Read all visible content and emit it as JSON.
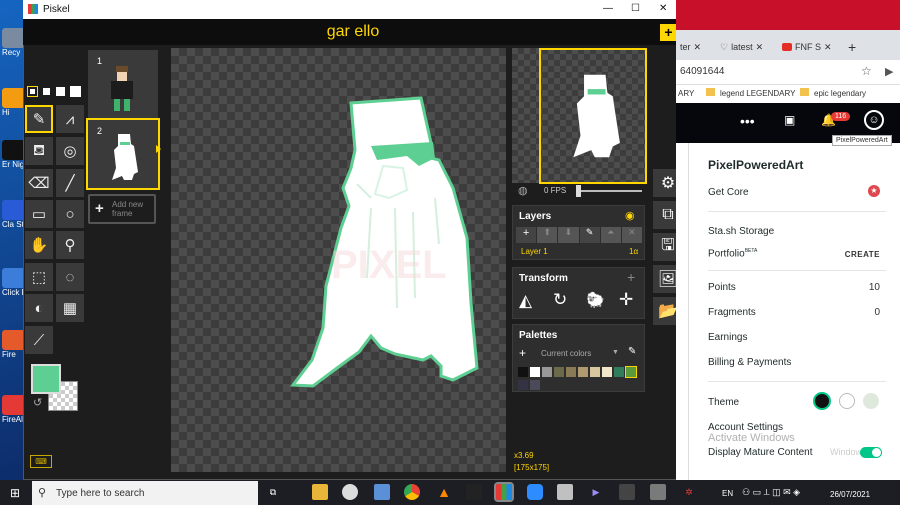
{
  "desktop": {
    "icons": [
      {
        "label": "Recy",
        "color": "#7a8aa0"
      },
      {
        "label": "Hi",
        "color": "#f39c12"
      },
      {
        "label": "Er Night",
        "color": "#111111"
      },
      {
        "label": "Cla Sto",
        "color": "#2a5bd7"
      },
      {
        "label": "Click Fusio",
        "color": "#3b7dd8"
      },
      {
        "label": "Fire",
        "color": "#e55a2b"
      },
      {
        "label": "FireAl",
        "color": "#e53935"
      }
    ]
  },
  "piskel": {
    "window_title": "Piskel",
    "sprite_name": "gar ello",
    "window_controls": {
      "minimize": "—",
      "maximize": "☐",
      "close": "✕"
    },
    "frames": [
      {
        "number": "1"
      },
      {
        "number": "2"
      }
    ],
    "add_frame_label": "Add new frame",
    "pen_sizes_icon": "pen-size-selector",
    "fps_label": "0 FPS",
    "layers": {
      "title": "Layers",
      "layer_name": "Layer 1",
      "layer_opacity": "1α"
    },
    "transform": {
      "title": "Transform"
    },
    "palettes": {
      "title": "Palettes",
      "current_label": "Current colors",
      "colors": [
        "#111111",
        "#ffffff",
        "#999999",
        "#6b6b4a",
        "#8a7a55",
        "#b09a70",
        "#d8c8a0",
        "#f2e6c8",
        "#2f7d5a",
        "#5a9a3a",
        "#333344",
        "#4a4a5a"
      ]
    },
    "zoom_label": "x3.69",
    "size_label": "[175x175]",
    "primary_color": "#5ecf92",
    "accent": "#ffd700"
  },
  "browser": {
    "tabs": [
      {
        "label": "ter",
        "icon": "tab-icon"
      },
      {
        "label": "latest",
        "icon": "heart-icon"
      },
      {
        "label": "FNF S",
        "icon": "youtube-icon"
      }
    ],
    "address": "64091644",
    "bookmarks": [
      "ARY",
      "legend LEGENDARY",
      "epic legendary"
    ],
    "notification_count": "116",
    "tooltip": "PixelPoweredArt",
    "username": "PixelPoweredArt",
    "get_core": "Get Core",
    "stash": "Sta.sh Storage",
    "portfolio": "Portfolio",
    "portfolio_badge": "BETA",
    "create": "CREATE",
    "points_label": "Points",
    "points_value": "10",
    "fragments_label": "Fragments",
    "fragments_value": "0",
    "earnings": "Earnings",
    "billing": "Billing & Payments",
    "theme": "Theme",
    "account": "Account Settings",
    "mature": "Display Mature Content",
    "activate_title": "Activate Windows",
    "activate_sub": "Windows"
  },
  "taskbar": {
    "search_placeholder": "Type here to search",
    "lang": "EN",
    "date": "26/07/2021"
  }
}
